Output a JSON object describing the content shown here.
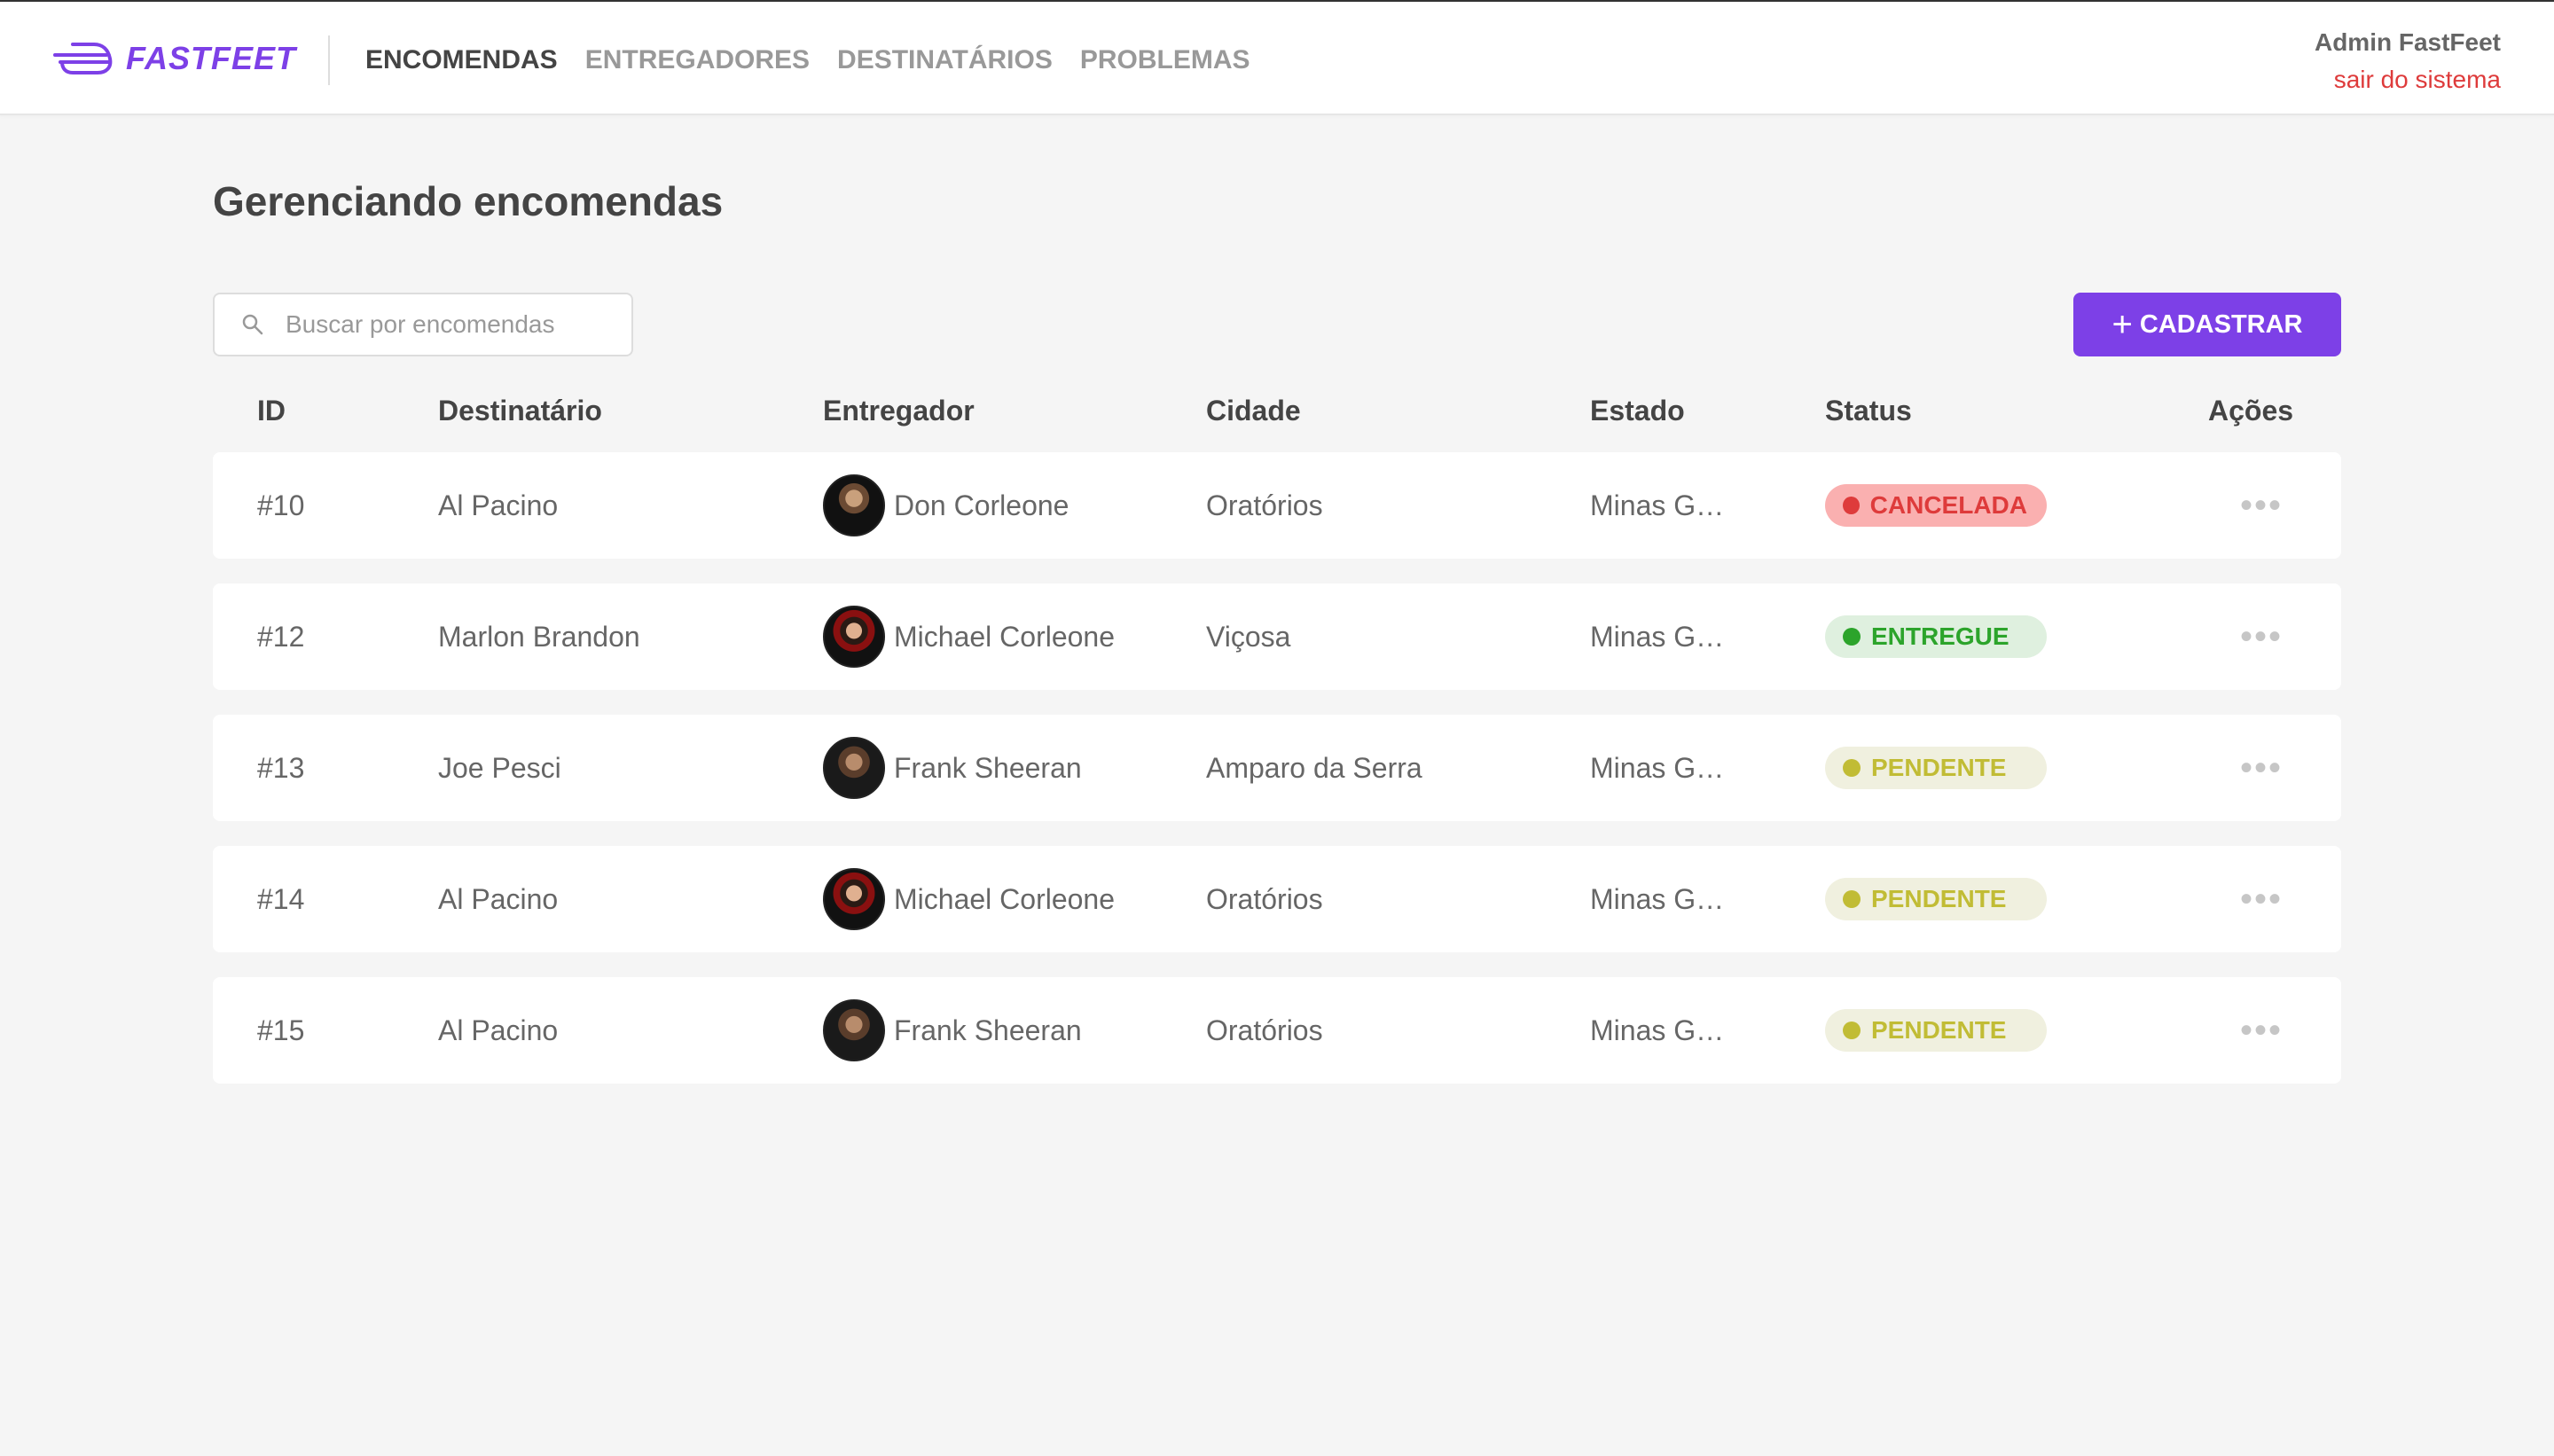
{
  "header": {
    "logo_text": "FASTFEET",
    "nav": [
      {
        "label": "ENCOMENDAS",
        "active": true
      },
      {
        "label": "ENTREGADORES",
        "active": false
      },
      {
        "label": "DESTINATÁRIOS",
        "active": false
      },
      {
        "label": "PROBLEMAS",
        "active": false
      }
    ],
    "user_name": "Admin FastFeet",
    "logout_label": "sair do sistema"
  },
  "page": {
    "title": "Gerenciando encomendas",
    "search_placeholder": "Buscar por encomendas",
    "add_button_label": "CADASTRAR"
  },
  "table": {
    "columns": [
      "ID",
      "Destinatário",
      "Entregador",
      "Cidade",
      "Estado",
      "Status",
      "Ações"
    ],
    "rows": [
      {
        "id": "#10",
        "recipient": "Al Pacino",
        "deliveryman": "Don Corleone",
        "city": "Oratórios",
        "state": "Minas Gerais",
        "status": "CANCELADA"
      },
      {
        "id": "#12",
        "recipient": "Marlon Brandon",
        "deliveryman": "Michael Corleone",
        "city": "Viçosa",
        "state": "Minas Gerais",
        "status": "ENTREGUE"
      },
      {
        "id": "#13",
        "recipient": "Joe Pesci",
        "deliveryman": "Frank Sheeran",
        "city": "Amparo da Serra",
        "state": "Minas Gerais",
        "status": "PENDENTE"
      },
      {
        "id": "#14",
        "recipient": "Al Pacino",
        "deliveryman": "Michael Corleone",
        "city": "Oratórios",
        "state": "Minas Gerais",
        "status": "PENDENTE"
      },
      {
        "id": "#15",
        "recipient": "Al Pacino",
        "deliveryman": "Frank Sheeran",
        "city": "Oratórios",
        "state": "Minas Gerais",
        "status": "PENDENTE"
      }
    ],
    "actions_label": "•••"
  },
  "colors": {
    "accent": "#7d40e7",
    "cancelada_bg": "#fab0b0",
    "cancelada_fg": "#de3b3b",
    "entregue_bg": "#dff0df",
    "entregue_fg": "#2ca42b",
    "pendente_bg": "#f0f0df",
    "pendente_fg": "#c1bc35"
  },
  "icons": {
    "logo": "fast-truck-icon",
    "search": "search-icon",
    "add": "plus-icon",
    "actions": "more-horizontal-icon"
  }
}
